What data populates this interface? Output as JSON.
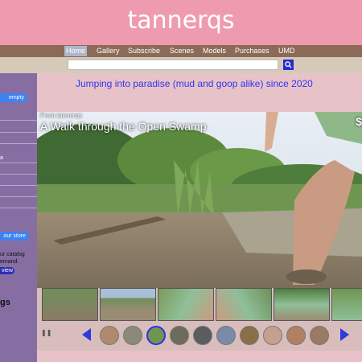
{
  "site": {
    "logo": "tannerqs"
  },
  "nav": {
    "items": [
      "Home",
      "Gallery",
      "Subscribe",
      "Scenes",
      "Models",
      "Purchases",
      "UMD"
    ],
    "active": "Home"
  },
  "search": {
    "placeholder": "",
    "button_icon": "search-icon"
  },
  "sidebar": {
    "cart_label": "empty",
    "fragment_1": "",
    "fragment_2": "a",
    "store_label": "our store",
    "catalog_line_1": "ur catalog",
    "catalog_line_2": "emand.",
    "view_label": "view",
    "heading": "gs"
  },
  "tagline": "Jumping into paradise (mud and goop alike) since 2020",
  "video": {
    "from_text": "From tannerqs",
    "title": "A Walk through the Open Swamp",
    "edge_glyph": "$"
  },
  "controls": {
    "pause_icon": "pause-icon",
    "prev_icon": "arrow-left-icon",
    "next_icon": "arrow-right-icon"
  },
  "colors": {
    "header": "#ee9bb0",
    "nav": "#8c6a58",
    "sidebar": "#866ea3",
    "accent": "#3c83f0",
    "tagline": "#3333ee"
  }
}
